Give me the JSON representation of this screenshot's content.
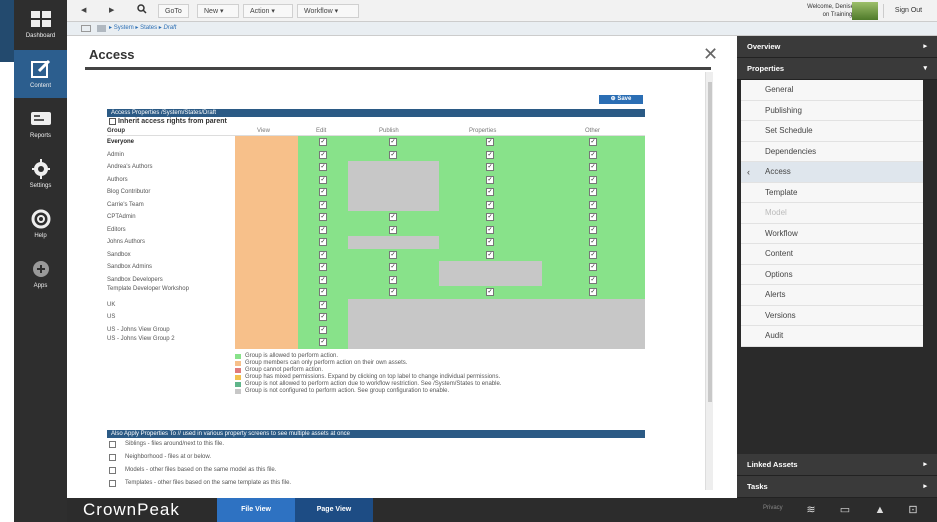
{
  "rail": [
    {
      "label": "Dashboard"
    },
    {
      "label": "Content"
    },
    {
      "label": "Reports"
    },
    {
      "label": "Settings"
    },
    {
      "label": "Help"
    },
    {
      "label": "Apps"
    }
  ],
  "toolbar": {
    "goto": "GoTo",
    "new": "New",
    "action": "Action",
    "workflow": "Workflow"
  },
  "breadcrumb": [
    "System",
    "States",
    "Draft"
  ],
  "user": {
    "welcome": "Welcome, Denise",
    "name": "on Training!",
    "signout": "Sign Out"
  },
  "access": {
    "title": "Access",
    "save": "Save",
    "header": "Access Properties /System/States/Draft",
    "inherit": "Inherit access rights from parent",
    "columns": [
      "Group",
      "View",
      "Edit",
      "Publish",
      "Properties",
      "Other"
    ],
    "groups": [
      {
        "name": "Everyone",
        "bold": true,
        "edit": true,
        "publish": "g",
        "properties": "g",
        "other": "g"
      },
      {
        "name": "Admin",
        "edit": true,
        "publish": "g",
        "properties": "g",
        "other": "g"
      },
      {
        "name": "Andrea's Authors",
        "edit": true,
        "publish": "x",
        "properties": "g",
        "other": "g"
      },
      {
        "name": "Authors",
        "edit": true,
        "publish": "x",
        "properties": "g",
        "other": "g"
      },
      {
        "name": "Blog Contributor",
        "edit": true,
        "publish": "x",
        "properties": "g",
        "other": "g"
      },
      {
        "name": "Carrie's Team",
        "edit": true,
        "publish": "x",
        "properties": "g",
        "other": "g"
      },
      {
        "name": "CPTAdmin",
        "edit": true,
        "publish": "g",
        "properties": "g",
        "other": "g"
      },
      {
        "name": "Editors",
        "edit": true,
        "publish": "g",
        "properties": "g",
        "other": "g"
      },
      {
        "name": "Johns Authors",
        "edit": true,
        "publish": "x",
        "properties": "g",
        "other": "g"
      },
      {
        "name": "Sandbox",
        "edit": true,
        "publish": "g",
        "properties": "g",
        "other": "g"
      },
      {
        "name": "Sandbox Admins",
        "edit": true,
        "publish": "g",
        "properties": "x",
        "other": "g"
      },
      {
        "name": "Sandbox Developers",
        "edit": true,
        "publish": "g",
        "properties": "x",
        "other": "g"
      },
      {
        "name": "Template Developer Workshop",
        "edit": true,
        "publish": "g",
        "properties": "g",
        "other": "g"
      },
      {
        "name": "UK",
        "edit": true,
        "publish": "x",
        "properties": "x",
        "other": "x"
      },
      {
        "name": "US",
        "edit": true,
        "publish": "x",
        "properties": "x",
        "other": "x"
      },
      {
        "name": "US - Johns View Group",
        "edit": true,
        "publish": "x",
        "properties": "x",
        "other": "x"
      },
      {
        "name": "US - Johns View Group 2",
        "edit": true,
        "publish": "x",
        "properties": "x",
        "other": "x"
      }
    ],
    "legend": [
      {
        "color": "#88e28a",
        "text": "Group is allowed to perform action."
      },
      {
        "color": "#f7c08a",
        "text": "Group members can only perform action on their own assets."
      },
      {
        "color": "#e07a7a",
        "text": "Group cannot perform action."
      },
      {
        "color": "#f2c14e",
        "text": "Group has mixed permissions. Expand by clicking on top label to change individual permissions."
      },
      {
        "color": "#5fb58a",
        "text": "Group is not allowed to perform action due to workflow restriction. See /System/States to enable."
      },
      {
        "color": "#c7c7c7",
        "text": "Group is not configured to perform action. See group configuration to enable."
      }
    ],
    "also_header": "Also Apply Properties To // used in various property screens to see multiple assets at once",
    "also_items": [
      "Siblings - files around/next to this file.",
      "Neighborhood - files at or below.",
      "Models - other files based on the same model as this file.",
      "Templates - other files based on the same template as this file."
    ]
  },
  "panel": {
    "overview": "Overview",
    "properties": "Properties",
    "items": [
      "General",
      "Publishing",
      "Set Schedule",
      "Dependencies",
      "Access",
      "Template",
      "Model",
      "Workflow",
      "Content",
      "Options",
      "Alerts",
      "Versions",
      "Audit"
    ],
    "linked_assets": "Linked Assets",
    "tasks": "Tasks"
  },
  "footer": {
    "logo": "CrownPeak",
    "file_view": "File View",
    "page_view": "Page View",
    "privacy": "Privacy"
  }
}
